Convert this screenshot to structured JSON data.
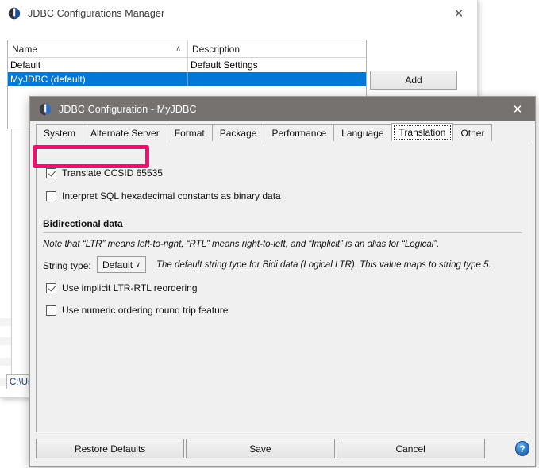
{
  "background_window": {
    "title": "JDBC Configurations Manager",
    "icon": "app-icon",
    "close_label": "✕",
    "table": {
      "columns": [
        "Name",
        "Description"
      ],
      "sort_indicator": "∧",
      "rows": [
        {
          "name": "Default",
          "description": "Default Settings",
          "selected": false
        },
        {
          "name": "MyJDBC (default)",
          "description": "",
          "selected": true
        }
      ]
    },
    "add_button": "Add",
    "path_chip": "C:\\Us"
  },
  "dialog": {
    "title": "JDBC Configuration - MyJDBC",
    "close_label": "✕",
    "tabs": [
      {
        "label": "System",
        "active": false
      },
      {
        "label": "Alternate Server",
        "active": false
      },
      {
        "label": "Format",
        "active": false
      },
      {
        "label": "Package",
        "active": false
      },
      {
        "label": "Performance",
        "active": false
      },
      {
        "label": "Language",
        "active": false
      },
      {
        "label": "Translation",
        "active": true
      },
      {
        "label": "Other",
        "active": false
      }
    ],
    "checkboxes": {
      "translate_ccsid": {
        "label": "Translate CCSID 65535",
        "checked": true,
        "highlighted": true
      },
      "interpret_hex": {
        "label": "Interpret SQL hexadecimal constants as binary data",
        "checked": false
      },
      "implicit_reorder": {
        "label": "Use implicit LTR-RTL reordering",
        "checked": true
      },
      "numeric_round_trip": {
        "label": "Use numeric ordering round trip feature",
        "checked": false
      }
    },
    "bidi_section": {
      "title": "Bidirectional data",
      "note": "Note that “LTR” means left-to-right, “RTL” means right-to-left, and “Implicit” is an alias for “Logical”.",
      "string_type_label": "String type:",
      "string_type_value": "Default",
      "string_type_caret": "∨",
      "string_type_help": "The default string type for Bidi data (Logical LTR). This value maps to string type 5."
    },
    "footer": {
      "restore_defaults": "Restore Defaults",
      "save": "Save",
      "cancel": "Cancel",
      "help": "?"
    }
  },
  "colors": {
    "highlight": "#f40d6e",
    "selection": "#0078d7",
    "dialog_titlebar": "#767270",
    "help_blue": "#2a74c4"
  }
}
